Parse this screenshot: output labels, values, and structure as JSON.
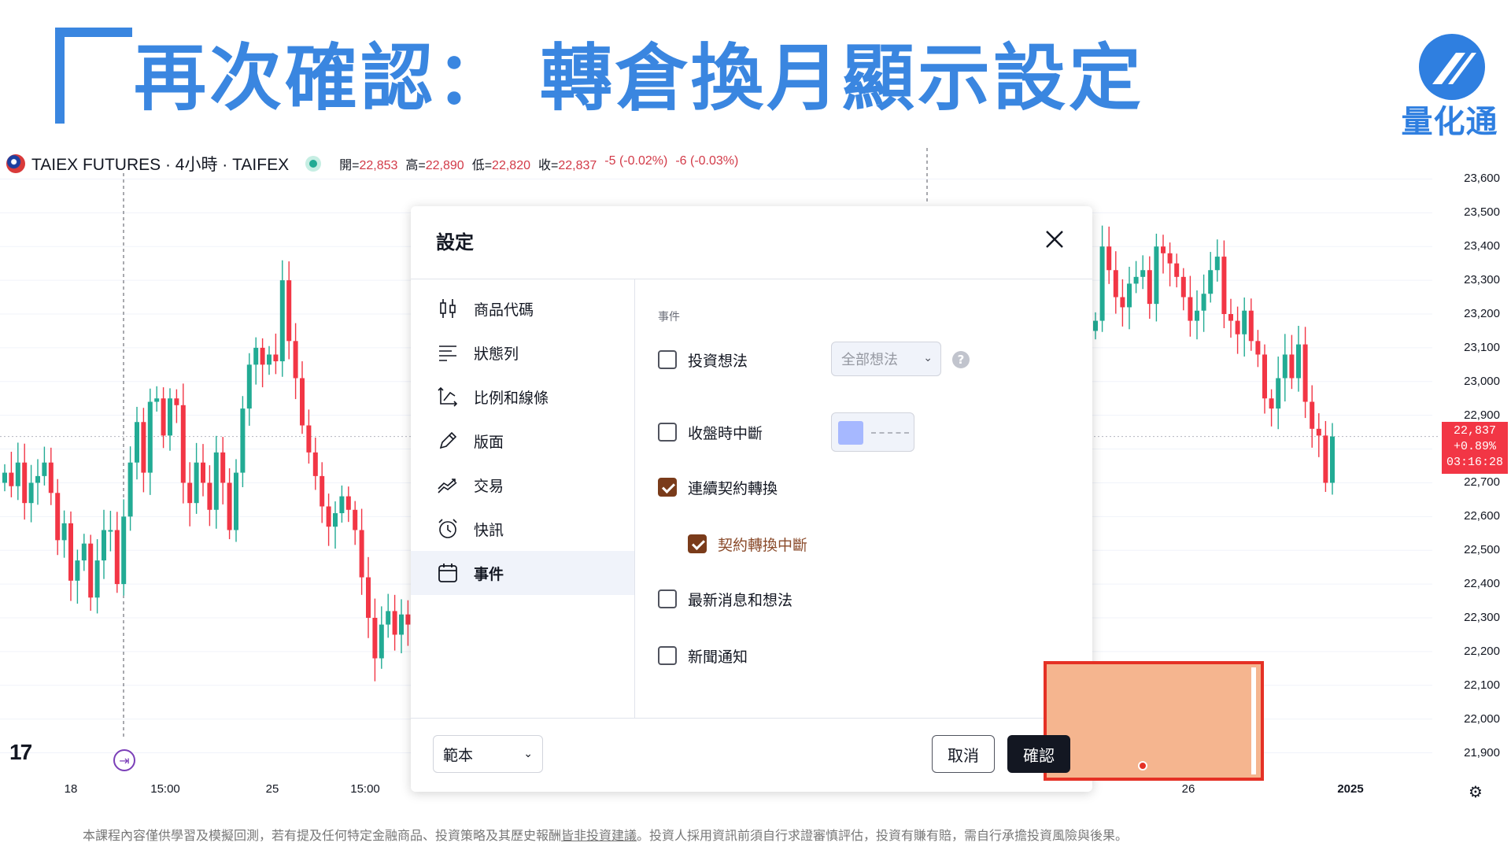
{
  "slide": {
    "title": "再次確認： 轉倉換月顯示設定",
    "logo_text": "量化通",
    "disclaimer_before": "本課程內容僅供學習及模擬回測，若有提及任何特定金融商品、投資策略及其歷史報酬",
    "disclaimer_underlined": "皆非投資建議",
    "disclaimer_after": "。投資人採用資訊前須自行求證審慎評估，投資有賺有賠，需自行承擔投資風險與後果。"
  },
  "chart_header": {
    "symbol": "TAIEX FUTURES · 4小時 · TAIFEX",
    "ohlc": [
      {
        "label": "開=",
        "value": "22,853"
      },
      {
        "label": "高=",
        "value": "22,890"
      },
      {
        "label": "低=",
        "value": "22,820"
      },
      {
        "label": "收=",
        "value": "22,837"
      },
      {
        "label": "",
        "value": "-5 (-0.02%)"
      },
      {
        "label": "",
        "value": "-6 (-0.03%)"
      }
    ]
  },
  "chart_data": {
    "type": "candlestick",
    "price_axis": [
      "23,600",
      "23,500",
      "23,400",
      "23,300",
      "23,200",
      "23,100",
      "23,000",
      "22,900",
      "22,800",
      "22,700",
      "22,600",
      "22,500",
      "22,400",
      "22,300",
      "22,200",
      "22,100",
      "22,000",
      "21,900"
    ],
    "time_axis": [
      "18",
      "15:00",
      "25",
      "15:00",
      "26",
      "2025"
    ],
    "ylim": [
      21850,
      23650
    ],
    "last_price": {
      "price": "22,837",
      "change_pct": "+0.89%",
      "countdown": "03:16:28"
    },
    "colors": {
      "up": "#22ab94",
      "down": "#f23645"
    },
    "left_closes": [
      22730,
      22690,
      22760,
      22640,
      22700,
      22720,
      22760,
      22670,
      22530,
      22580,
      22410,
      22470,
      22520,
      22360,
      22470,
      22560,
      22560,
      22400,
      22600,
      22760,
      22880,
      22730,
      22940,
      22950,
      22840,
      22950,
      22930,
      22700,
      22640,
      22760,
      22700,
      22620,
      22790,
      22700,
      22560,
      22730,
      22920,
      23050,
      23100,
      23050,
      23080,
      23060,
      23300,
      23120,
      23010,
      22870,
      22790,
      22720,
      22630,
      22570,
      22610,
      22660,
      22620,
      22560,
      22420,
      22300,
      22180,
      22280,
      22320,
      22250,
      22310,
      22280
    ],
    "right_closes": [
      23180,
      23400,
      23330,
      23250,
      23220,
      23290,
      23310,
      23330,
      23230,
      23400,
      23380,
      23350,
      23310,
      23250,
      23180,
      23210,
      23260,
      23330,
      23370,
      23200,
      23180,
      23140,
      23210,
      23120,
      23080,
      22950,
      22920,
      23010,
      23080,
      23010,
      23110,
      22940,
      22860,
      22840,
      22700,
      22837
    ]
  },
  "dialog": {
    "title": "設定",
    "nav": [
      {
        "label": "商品代碼",
        "icon": "candlestick-icon"
      },
      {
        "label": "狀態列",
        "icon": "status-line-icon"
      },
      {
        "label": "比例和線條",
        "icon": "scales-lines-icon"
      },
      {
        "label": "版面",
        "icon": "pencil-icon"
      },
      {
        "label": "交易",
        "icon": "trading-icon"
      },
      {
        "label": "快訊",
        "icon": "alarm-clock-icon"
      },
      {
        "label": "事件",
        "icon": "calendar-icon"
      }
    ],
    "active_nav": "事件",
    "section_heading": "事件",
    "options": {
      "ideas": {
        "label": "投資想法",
        "checked": false,
        "select_value": "全部想法"
      },
      "session_breaks": {
        "label": "收盤時中斷",
        "checked": false,
        "swatch_color": "#a6b8ff"
      },
      "rollover": {
        "label": "連續契約轉換",
        "checked": true
      },
      "rollover_breaks": {
        "label": "契約轉換中斷",
        "checked": true
      },
      "latest_news": {
        "label": "最新消息和想法",
        "checked": false
      },
      "news_alerts": {
        "label": "新聞通知",
        "checked": false
      }
    },
    "footer": {
      "template_label": "範本",
      "cancel_label": "取消",
      "confirm_label": "確認"
    },
    "help_glyph": "?"
  }
}
